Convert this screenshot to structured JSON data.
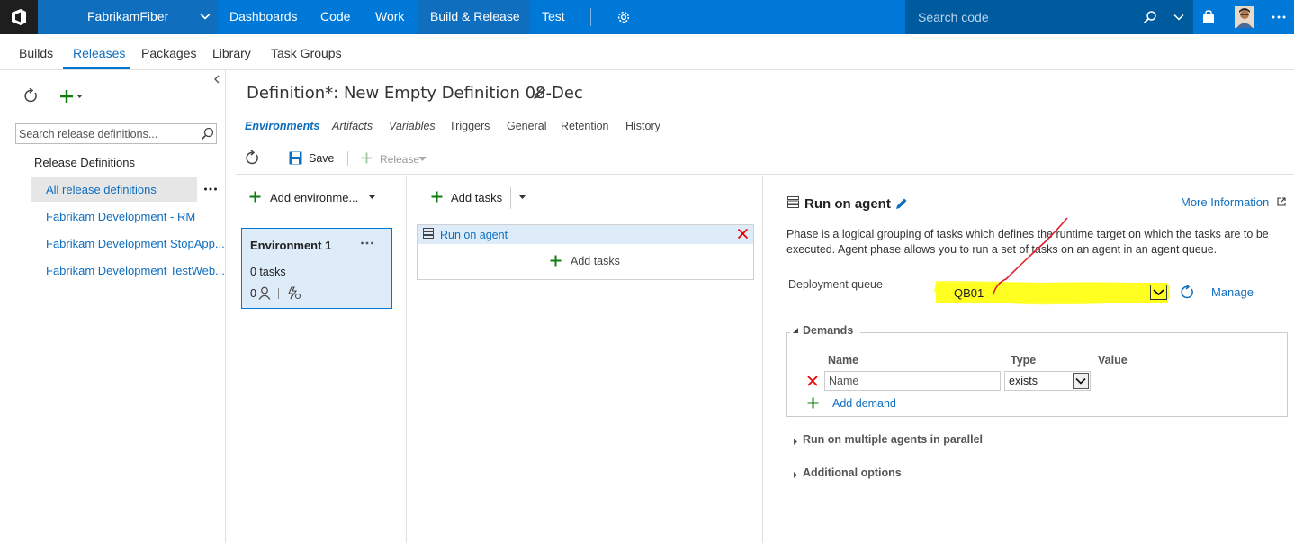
{
  "topbar": {
    "project": "FabrikamFiber",
    "nav": [
      "Dashboards",
      "Code",
      "Work",
      "Build & Release",
      "Test"
    ],
    "search_placeholder": "Search code"
  },
  "hub": {
    "items": [
      "Builds",
      "Releases",
      "Packages",
      "Library",
      "Task Groups"
    ],
    "active": "Releases"
  },
  "left": {
    "search_placeholder": "Search release definitions...",
    "section_title": "Release Definitions",
    "items": [
      "All release definitions",
      "Fabrikam Development - RM",
      "Fabrikam Development StopApp...",
      "Fabrikam Development TestWeb..."
    ]
  },
  "definition": {
    "title": "Definition*: New Empty Definition 08-Dec",
    "tabs": [
      "Environments",
      "Artifacts",
      "Variables",
      "Triggers",
      "General",
      "Retention",
      "History"
    ],
    "active_tab": "Environments"
  },
  "toolbar": {
    "save": "Save",
    "release": "Release"
  },
  "environments": {
    "add_label": "Add environme...",
    "card": {
      "name": "Environment 1",
      "tasks": "0 tasks",
      "approvers": "0"
    }
  },
  "tasks": {
    "add_label": "Add tasks",
    "phase_name": "Run on agent",
    "add_inner": "Add tasks"
  },
  "phase_panel": {
    "title": "Run on agent",
    "more_info": "More Information",
    "description_1": "Phase is a logical grouping of tasks which defines the runtime target on which the tasks are to be",
    "description_2": "executed. Agent phase allows you to run a set of tasks on an agent in an agent queue.",
    "queue_label": "Deployment queue",
    "queue_value": "QB01",
    "manage": "Manage",
    "demands": {
      "title": "Demands",
      "col_name": "Name",
      "col_type": "Type",
      "col_value": "Value",
      "name_placeholder": "Name",
      "type_value": "exists",
      "add": "Add demand"
    },
    "parallel": "Run on multiple agents in parallel",
    "additional": "Additional options"
  },
  "colors": {
    "accent": "#0078d7",
    "highlight": "#ffff22",
    "annotation": "#e0202a"
  }
}
